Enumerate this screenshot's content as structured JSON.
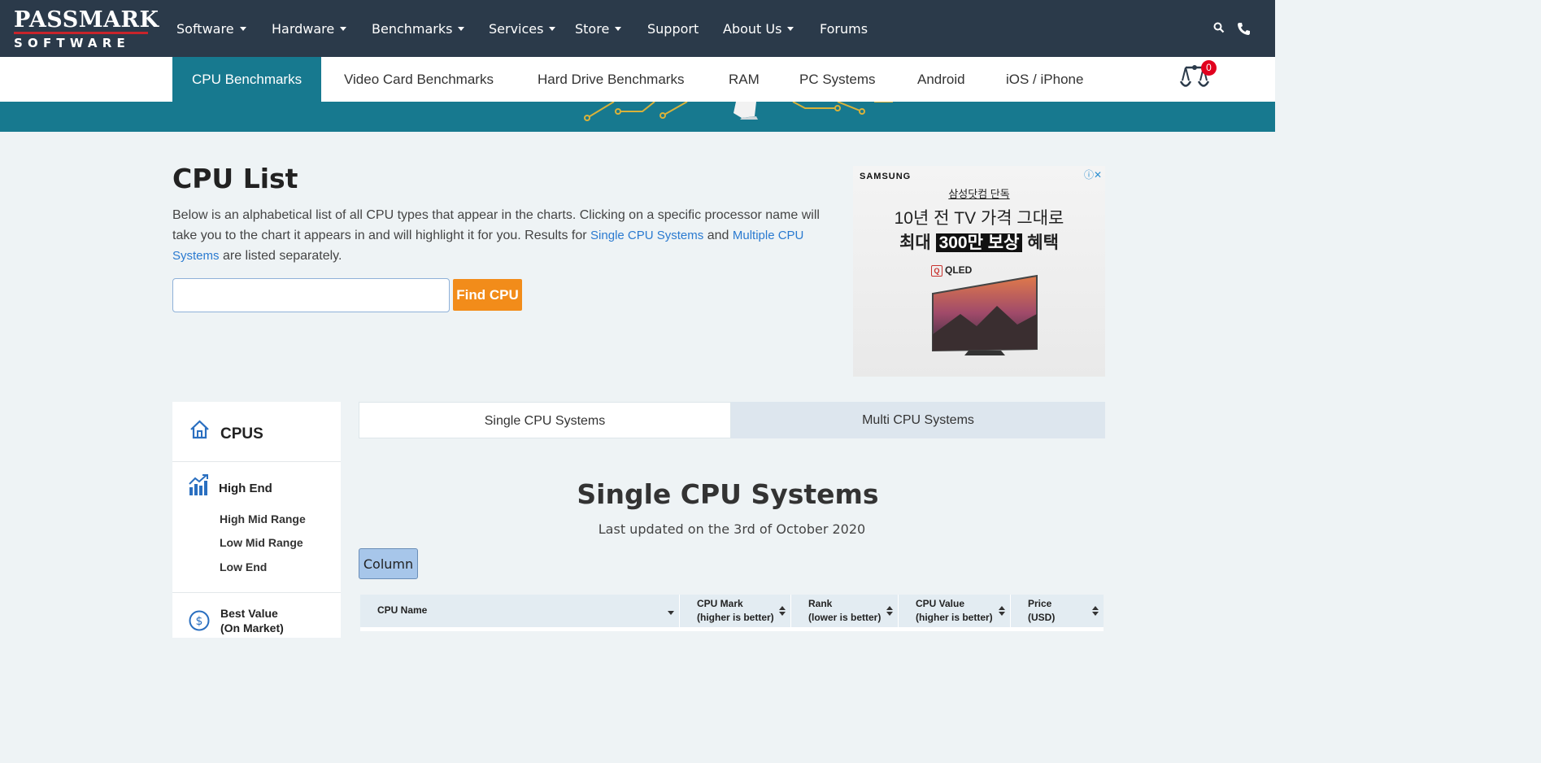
{
  "logo": {
    "line1": "PASSMARK",
    "line2": "SOFTWARE"
  },
  "top_nav": [
    {
      "label": "Software",
      "caret": true
    },
    {
      "label": "Hardware",
      "caret": true
    },
    {
      "label": "Benchmarks",
      "caret": true
    },
    {
      "label": "Services",
      "caret": true
    },
    {
      "label": "Store",
      "caret": true
    },
    {
      "label": "Support",
      "caret": false
    },
    {
      "label": "About Us",
      "caret": true
    },
    {
      "label": "Forums",
      "caret": false
    }
  ],
  "sub_nav": {
    "tabs": [
      "CPU Benchmarks",
      "Video Card Benchmarks",
      "Hard Drive Benchmarks",
      "RAM",
      "PC Systems",
      "Android",
      "iOS / iPhone"
    ],
    "active": "CPU Benchmarks",
    "compare_count": "0"
  },
  "page": {
    "title": "CPU List",
    "intro_text_1": "Below is an alphabetical list of all CPU types that appear in the charts. Clicking on a specific processor name will take you to the chart it appears in and will highlight it for you. Results for ",
    "intro_link_1": "Single CPU Systems",
    "intro_text_2": " and ",
    "intro_link_2": "Multiple CPU Systems",
    "intro_text_3": " are listed separately.",
    "search_value": "",
    "find_button": "Find CPU"
  },
  "ad": {
    "brand": "SAMSUNG",
    "line1": "삼성닷컴 단독",
    "line2": "10년 전 TV 가격 그대로",
    "line3_a": "최대 ",
    "line3_hl": "300만 보상",
    "line3_b": " 혜택",
    "product": "QLED"
  },
  "sidebar": {
    "title": "CPUS",
    "high_end": "High End",
    "subs": [
      "High Mid Range",
      "Low Mid Range",
      "Low End"
    ],
    "best_value": "Best Value",
    "best_value_sub": "(On Market)"
  },
  "systabs": {
    "single": "Single CPU Systems",
    "multi": "Multi CPU Systems"
  },
  "section": {
    "title": "Single CPU Systems",
    "updated": "Last updated on the 3rd of October 2020",
    "column_button": "Column"
  },
  "table": {
    "columns": [
      {
        "line1": "CPU Name",
        "line2": ""
      },
      {
        "line1": "CPU Mark",
        "line2": "(higher is better)"
      },
      {
        "line1": "Rank",
        "line2": "(lower is better)"
      },
      {
        "line1": "CPU Value",
        "line2": "(higher is better)"
      },
      {
        "line1": "Price",
        "line2": "(USD)"
      }
    ]
  },
  "colors": {
    "topbar": "#2b3a4a",
    "accent_teal": "#17798f",
    "find_button": "#f28c1a",
    "link": "#2a7ad0"
  }
}
